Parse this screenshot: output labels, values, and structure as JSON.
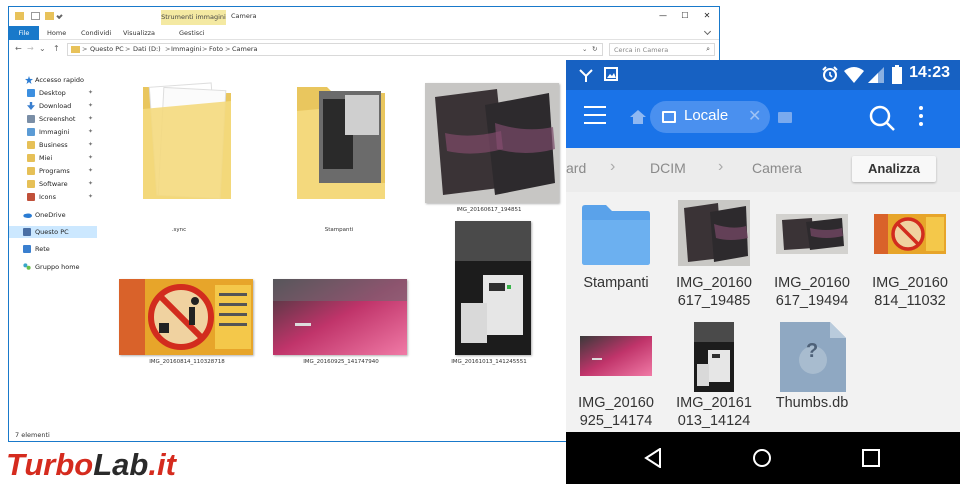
{
  "explorer": {
    "tools_tab": "Strumenti immagini",
    "window_title": "Camera",
    "controls": {
      "minimize": "—",
      "maximize": "☐",
      "close": "✕"
    },
    "ribbon_tabs": [
      "File",
      "Home",
      "Condividi",
      "Visualizza",
      "Gestisci"
    ],
    "nav_glyphs": {
      "back": "←",
      "forward": "→",
      "recent": "⌄",
      "up": "↑",
      "refresh": "↻",
      "dropdown": "⌄"
    },
    "breadcrumb": [
      "Questo PC",
      "Dati (D:)",
      "Immagini",
      "Foto",
      "Camera"
    ],
    "crumb_separator": ">",
    "search_placeholder": "Cerca in Camera",
    "search_glyph": "⌕",
    "pin_glyph": "✦",
    "nav": [
      {
        "label": "Accesso rapido",
        "icon": "star-icon",
        "color": "#2b7cd3"
      },
      {
        "label": "Desktop",
        "icon": "desktop-icon",
        "color": "#3c8fe0",
        "pinned": true
      },
      {
        "label": "Download",
        "icon": "download-icon",
        "color": "#3a7fcf",
        "pinned": true
      },
      {
        "label": "Screenshot",
        "icon": "screenshot-icon",
        "color": "#7a8ea6",
        "pinned": true
      },
      {
        "label": "Immagini",
        "icon": "pictures-icon",
        "color": "#5b9bd5",
        "pinned": true
      },
      {
        "label": "Business",
        "icon": "folder-icon",
        "color": "#e6c057",
        "pinned": true
      },
      {
        "label": "Miei",
        "icon": "folder-icon",
        "color": "#e6c057",
        "pinned": true
      },
      {
        "label": "Programs",
        "icon": "folder-icon",
        "color": "#e6c057",
        "pinned": true
      },
      {
        "label": "Software",
        "icon": "folder-icon",
        "color": "#e6c057",
        "pinned": true
      },
      {
        "label": "Icons",
        "icon": "icons-folder-icon",
        "color": "#c0503a",
        "pinned": true
      },
      {
        "label": "OneDrive",
        "icon": "onedrive-icon",
        "color": "#2b7cd3"
      },
      {
        "label": "Questo PC",
        "icon": "computer-icon",
        "color": "#4a6fa5",
        "selected": true
      },
      {
        "label": "Rete",
        "icon": "network-icon",
        "color": "#3a7fcf"
      },
      {
        "label": "Gruppo home",
        "icon": "homegroup-icon",
        "color": "#3aa6c8"
      }
    ],
    "files": [
      {
        "name": ".sync",
        "kind": "folder-doc"
      },
      {
        "name": "Stampanti",
        "kind": "folder-photo"
      },
      {
        "name": "IMG_20160617_194851",
        "kind": "photo-books"
      },
      {
        "name": "IMG_20160814_110328718",
        "kind": "photo-sign"
      },
      {
        "name": "IMG_20160925_141747940",
        "kind": "photo-pink"
      },
      {
        "name": "IMG_20161013_141245551",
        "kind": "photo-printer"
      }
    ],
    "status": "7 elementi"
  },
  "phone": {
    "time": "14:23",
    "location_chip": "Locale",
    "chip_close": "✕",
    "path": [
      "ard",
      "DCIM",
      "Camera"
    ],
    "path_separator": "›",
    "analyze_button": "Analizza",
    "thumbs_glyph": "?",
    "files": [
      {
        "line1": "Stampanti",
        "line2": "",
        "kind": "folder"
      },
      {
        "line1": "IMG_20160",
        "line2": "617_19485",
        "kind": "photo-books"
      },
      {
        "line1": "IMG_20160",
        "line2": "617_19494",
        "kind": "photo-books-wide"
      },
      {
        "line1": "IMG_20160",
        "line2": "814_11032",
        "kind": "photo-sign"
      },
      {
        "line1": "IMG_20160",
        "line2": "925_14174",
        "kind": "photo-pink"
      },
      {
        "line1": "IMG_20161",
        "line2": "013_14124",
        "kind": "photo-printer"
      },
      {
        "line1": "Thumbs.db",
        "line2": "",
        "kind": "unknown"
      }
    ]
  },
  "watermark": {
    "part1": "Turbo",
    "part2": "Lab",
    "part3": ".it"
  },
  "colors": {
    "accent": "#1979ca",
    "phone_bar": "#1a73e8",
    "phone_status": "#1761c2",
    "folder": "#f2d676",
    "watermark": "#d52b1e"
  }
}
